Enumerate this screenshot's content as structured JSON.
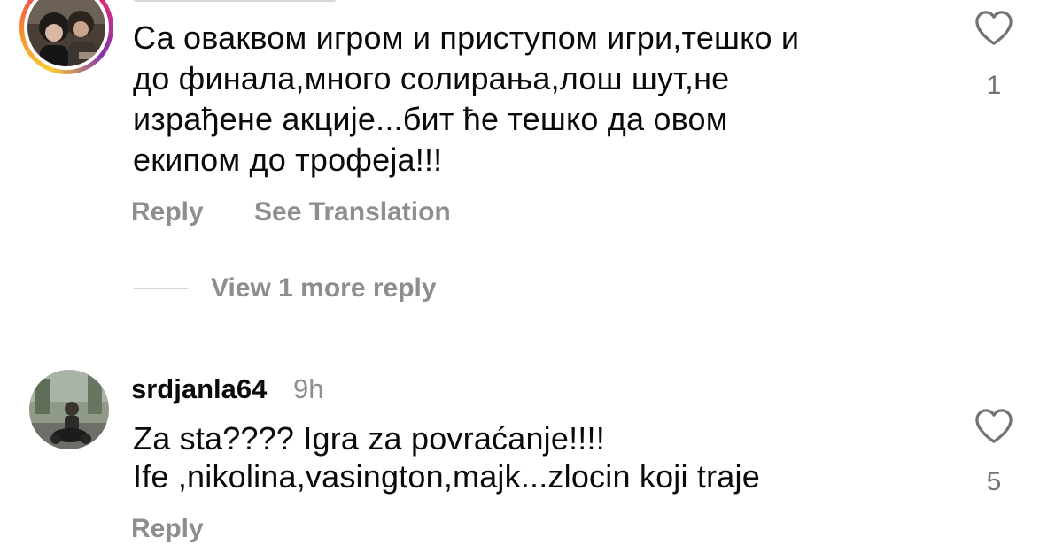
{
  "comments": [
    {
      "lines": [
        "Са оваквом игром и приступом игри,тешко и",
        "до финала,много солирања,лош шут,не",
        "израђене акције...бит ће тешко да овом",
        "екипом до трофеја!!!"
      ],
      "reply_label": "Reply",
      "translate_label": "See Translation",
      "view_replies_label": "View 1 more reply",
      "like_count": "1"
    },
    {
      "username": "srdjanla64",
      "time": "9h",
      "lines": [
        "Za sta???? Igra za povraćanje!!!!",
        "Ife ,nikolina,vasington,majk...zlocin koji traje"
      ],
      "reply_label": "Reply",
      "like_count": "5"
    }
  ],
  "icons": {
    "like": "heart-outline-icon"
  },
  "colors": {
    "text": "#0a0a0a",
    "secondary": "#8e8e8e",
    "story_ring": [
      "#f9ce34",
      "#ee2a7b",
      "#8134af"
    ]
  }
}
